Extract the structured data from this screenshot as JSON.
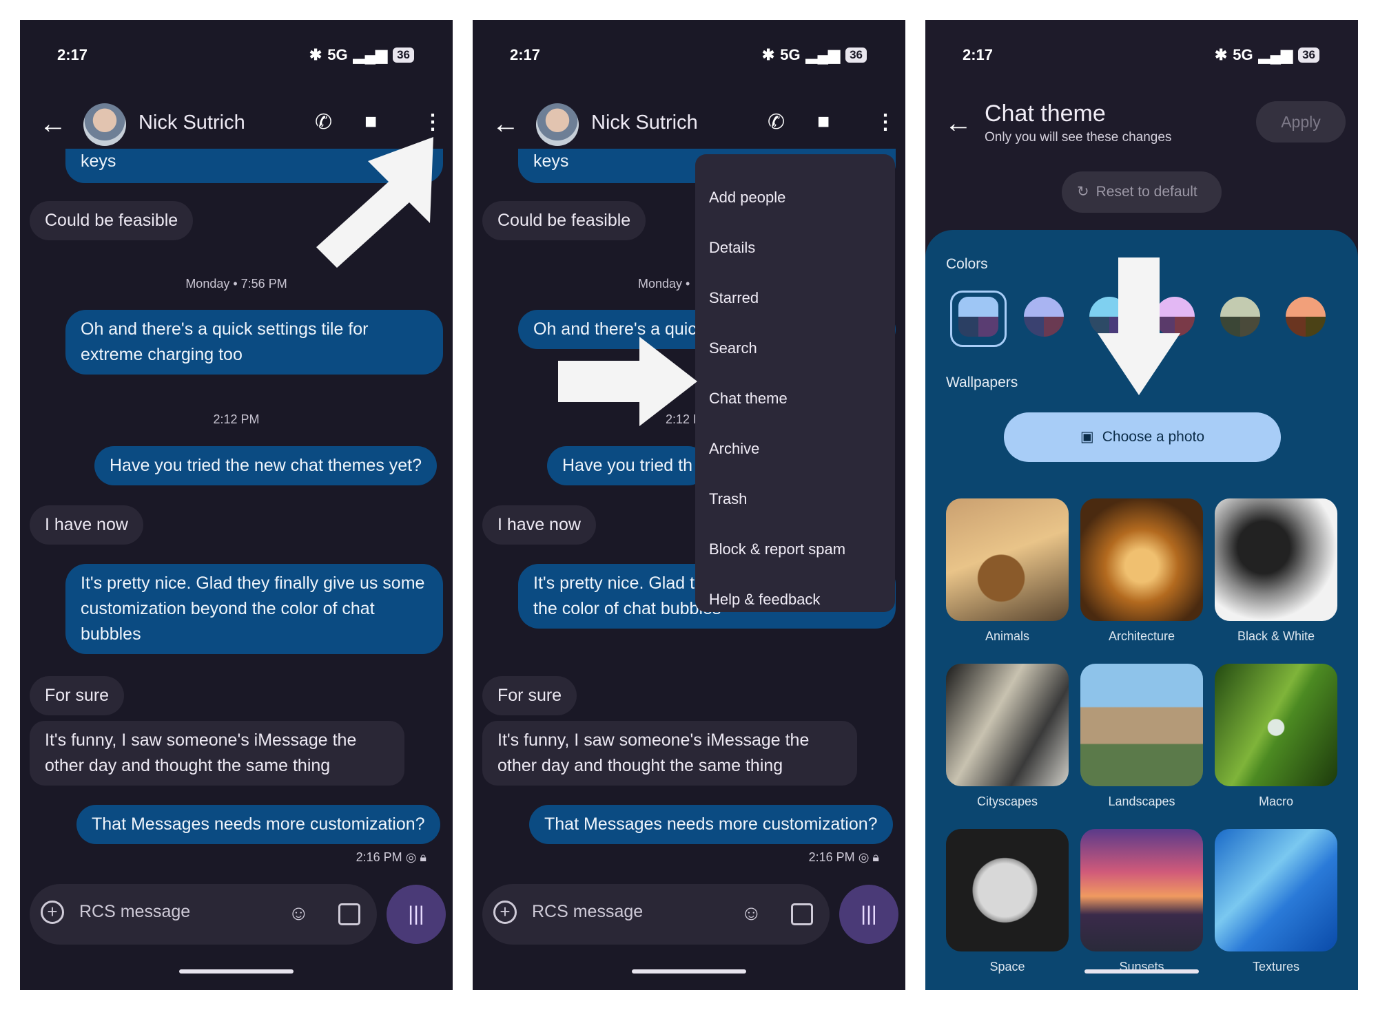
{
  "status": {
    "time": "2:17",
    "network": "5G",
    "battery": "36"
  },
  "contact": {
    "name": "Nick Sutrich"
  },
  "messages": {
    "m0": "keys",
    "m1": "Could be feasible",
    "t1": "Monday • 7:56 PM",
    "m2": "Oh and there's a quick settings tile for extreme charging too",
    "t2": "2:12 PM",
    "m3": "Have you tried the new chat themes yet?",
    "m4": "I have now",
    "m5": "It's pretty nice. Glad they finally give us some customization beyond the color of chat bubbles",
    "m6": "For sure",
    "m7": "It's funny, I saw someone's iMessage the other day and thought the same thing",
    "m8": "That Messages needs more customization?",
    "meta": "2:16 PM"
  },
  "p2": {
    "t1": "Monday •",
    "m2": "Oh and there's a quic extreme charg too",
    "t2": "2:12 P",
    "m3": "Have you tried th",
    "m5": "It's pretty nice. Glad t customization beyond the color of chat bubbles"
  },
  "compose": {
    "placeholder": "RCS message"
  },
  "menu": [
    "Add people",
    "Details",
    "Starred",
    "Search",
    "Chat theme",
    "Archive",
    "Trash",
    "Block & report spam",
    "Help & feedback"
  ],
  "theme": {
    "title": "Chat theme",
    "subtitle": "Only you will see these changes",
    "apply": "Apply",
    "reset": "Reset to default",
    "colors_label": "Colors",
    "wallpapers_label": "Wallpapers",
    "choose_photo": "Choose a photo",
    "tiles": [
      "Animals",
      "Architecture",
      "Black & White",
      "Cityscapes",
      "Landscapes",
      "Macro",
      "Space",
      "Sunsets",
      "Textures"
    ]
  },
  "swatches": [
    {
      "top": "#9ec6f5",
      "bl": "#2b3f63",
      "br": "#5a3d72"
    },
    {
      "top": "#a9b4f2",
      "bl": "#3a4170",
      "br": "#6a3a52"
    },
    {
      "top": "#7fd0f0",
      "bl": "#2d4a66",
      "br": "#4a3b7a"
    },
    {
      "top": "#e3b8f4",
      "bl": "#5a3a6a",
      "br": "#7a3a48"
    },
    {
      "top": "#c3cbb0",
      "bl": "#3b4636",
      "br": "#4a4a3a"
    },
    {
      "top": "#f2a07a",
      "bl": "#6a3520",
      "br": "#4b4216"
    }
  ],
  "icons": [
    "back-arrow-icon",
    "phone-icon",
    "video-icon",
    "more-vert-icon",
    "add-icon",
    "emoji-icon",
    "image-icon",
    "voice-icon",
    "lock-icon",
    "read-receipt-icon",
    "reset-icon",
    "photo-library-icon"
  ]
}
